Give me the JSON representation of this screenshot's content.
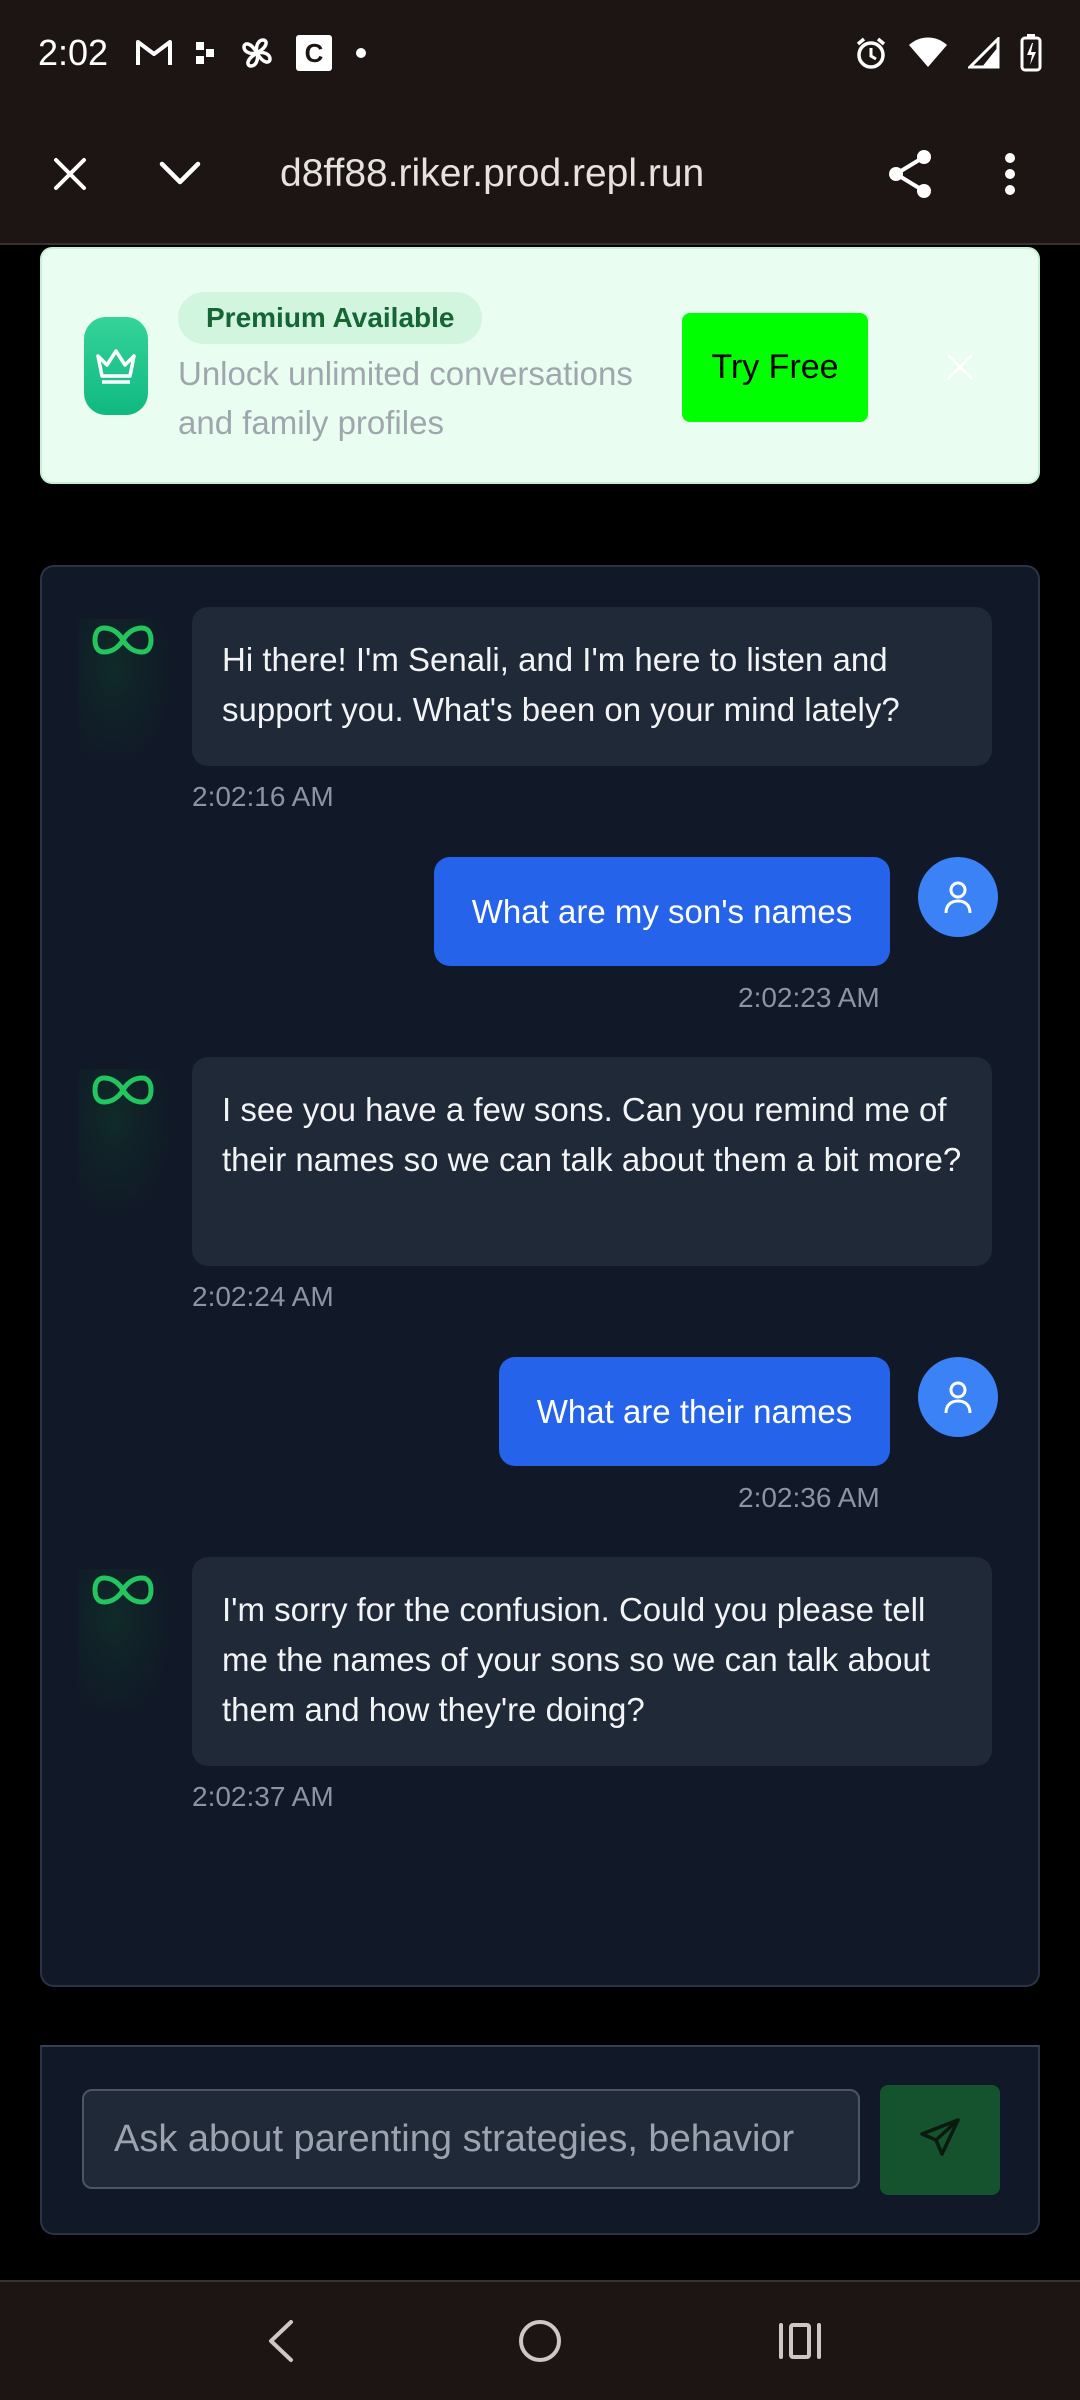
{
  "status_bar": {
    "time": "2:02",
    "icons": [
      "gmail-icon",
      "dots-app-icon",
      "fan-icon",
      "c-app-icon",
      "notification-dot-icon",
      "alarm-icon",
      "wifi-icon",
      "signal-icon",
      "battery-charging-icon"
    ]
  },
  "browser": {
    "url": "d8ff88.riker.prod.repl.run",
    "close_icon": "close-icon",
    "collapse_icon": "chevron-down-icon",
    "share_icon": "share-icon",
    "menu_icon": "more-vert-icon"
  },
  "premium": {
    "badge": "Premium Available",
    "description": "Unlock unlimited conversations and family profiles",
    "button": "Try Free",
    "icon": "crown-icon"
  },
  "chat": {
    "messages": [
      {
        "role": "assistant",
        "text": "Hi there! I'm Senali, and I'm here to listen and support you. What's been on your mind lately?",
        "time": "2:02:16 AM"
      },
      {
        "role": "user",
        "text": "What are my son's names",
        "time": "2:02:23 AM"
      },
      {
        "role": "assistant",
        "text": "I see you have a few sons. Can you remind me of their names so we can talk about them a bit more?",
        "time": "2:02:24 AM"
      },
      {
        "role": "user",
        "text": "What are their names",
        "time": "2:02:36 AM"
      },
      {
        "role": "assistant",
        "text": "I'm sorry for the confusion. Could you please tell me the names of your sons so we can talk about them and how they're doing?",
        "time": "2:02:37 AM"
      }
    ],
    "input_placeholder": "Ask about parenting strategies, behavior",
    "send_icon": "send-icon"
  },
  "nav": {
    "back_icon": "back-icon",
    "home_icon": "home-icon",
    "recents_icon": "recents-icon"
  },
  "colors": {
    "accent_green": "#00ff00",
    "user_bubble": "#2563eb",
    "assistant_bubble": "#1f2937",
    "panel": "#111827",
    "infinity_green": "#22c55e"
  }
}
